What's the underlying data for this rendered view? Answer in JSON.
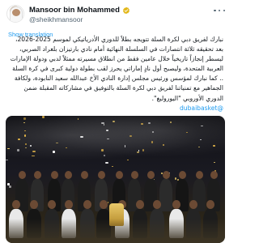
{
  "author": {
    "name": "Mansoor bin Mohammed",
    "handle": "@sheikhmansoor",
    "verified_color": "#e2b719"
  },
  "translation_label": "Show translation",
  "post": {
    "lines": [
      "نبارك لفريق دبي لكرة السلة تتويجه بطلاً للدوري الأدرياتيكي لموسم 2025-2026،",
      "بعد تحقيقه ثلاثة انتصارات في السلسلة النهائية أمام نادي بارتيزان بلغراد الصربي،",
      "ليسطر إنجازاً تاريخياً خلال عامين فقط من انطلاق مسيرته ممثلاً لدبي ودولة الإمارات",
      "العربية المتحدة، وليصبح أول نادٍ إماراتي يحرز لقب بطولة دولية كبرى في كرة السلة",
      ".. كما نبارك لمؤسس ورئيس مجلس إدارة النادي الأخ عبدالله سعيد النابودة، ولكافة",
      "الجماهير مع تمنياتنا لفريق دبي لكرة السلة بالتوفيق في مشاركاته المقبلة ضمن",
      "الدوري الأوروبي \"اليوروليغ\"."
    ],
    "hashtag": "@dubaibasket"
  },
  "photo": {
    "description_icon": "team-celebration-photo"
  }
}
